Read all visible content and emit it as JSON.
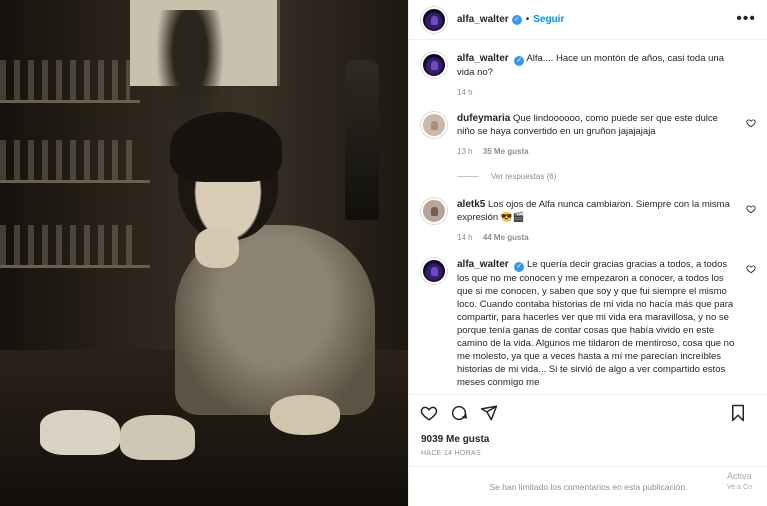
{
  "header": {
    "username": "alfa_walter",
    "separator": "•",
    "follow_label": "Seguir",
    "more_label": "•••"
  },
  "caption": {
    "username": "alfa_walter",
    "text": "Alfa.... Hace un montón de años, casi toda una vida no?",
    "time": "14 h"
  },
  "comments": [
    {
      "username": "dufeymaria",
      "text": "Que lindoooooo, como puede ser que este dulce niño se haya convertido en un gruñon jajajajaja",
      "time": "13 h",
      "likes": "35 Me gusta",
      "replies": "Ver respuestas (6)"
    },
    {
      "username": "aletk5",
      "text": "Los ojos de Alfa nunca cambiaron. Siempre con la misma expresión 😎🎬",
      "time": "14 h",
      "likes": "44 Me gusta"
    },
    {
      "username": "alfa_walter",
      "text": "Le quería decir gracias gracias a todos, a todos los que no me conocen y me empezaron a conocer, a todos los que si me conocen, y saben que soy y que fui siempre el mismo loco. Cuando contaba historias de mi vida no hacía más que para compartir, para hacerles ver que mi vida era maravillosa, y no se porque tenía ganas de contar cosas que había vivido en este camino de la vida. Algunos me tildaron de mentiroso, cosa que no me molesto, ya que a veces hasta a mí me parecían increíbles historias de mi vida... Si te sirvió de algo a ver compartido estos meses conmigo me"
    }
  ],
  "post": {
    "likes": "9039 Me gusta",
    "ago": "HACE 14 HORAS",
    "comments_limited": "Se han limitado los comentarios en esta publicación."
  },
  "watermark": {
    "line1": "Activa",
    "line2": "Ve a Co"
  },
  "icons": [
    "heart-icon",
    "comment-icon",
    "share-icon",
    "bookmark-icon",
    "verified-badge-icon",
    "more-options-icon",
    "like-comment-icon"
  ],
  "colors": {
    "link": "#0095f6",
    "verified": "#3897f0",
    "secondary_text": "#8e8e8e"
  }
}
